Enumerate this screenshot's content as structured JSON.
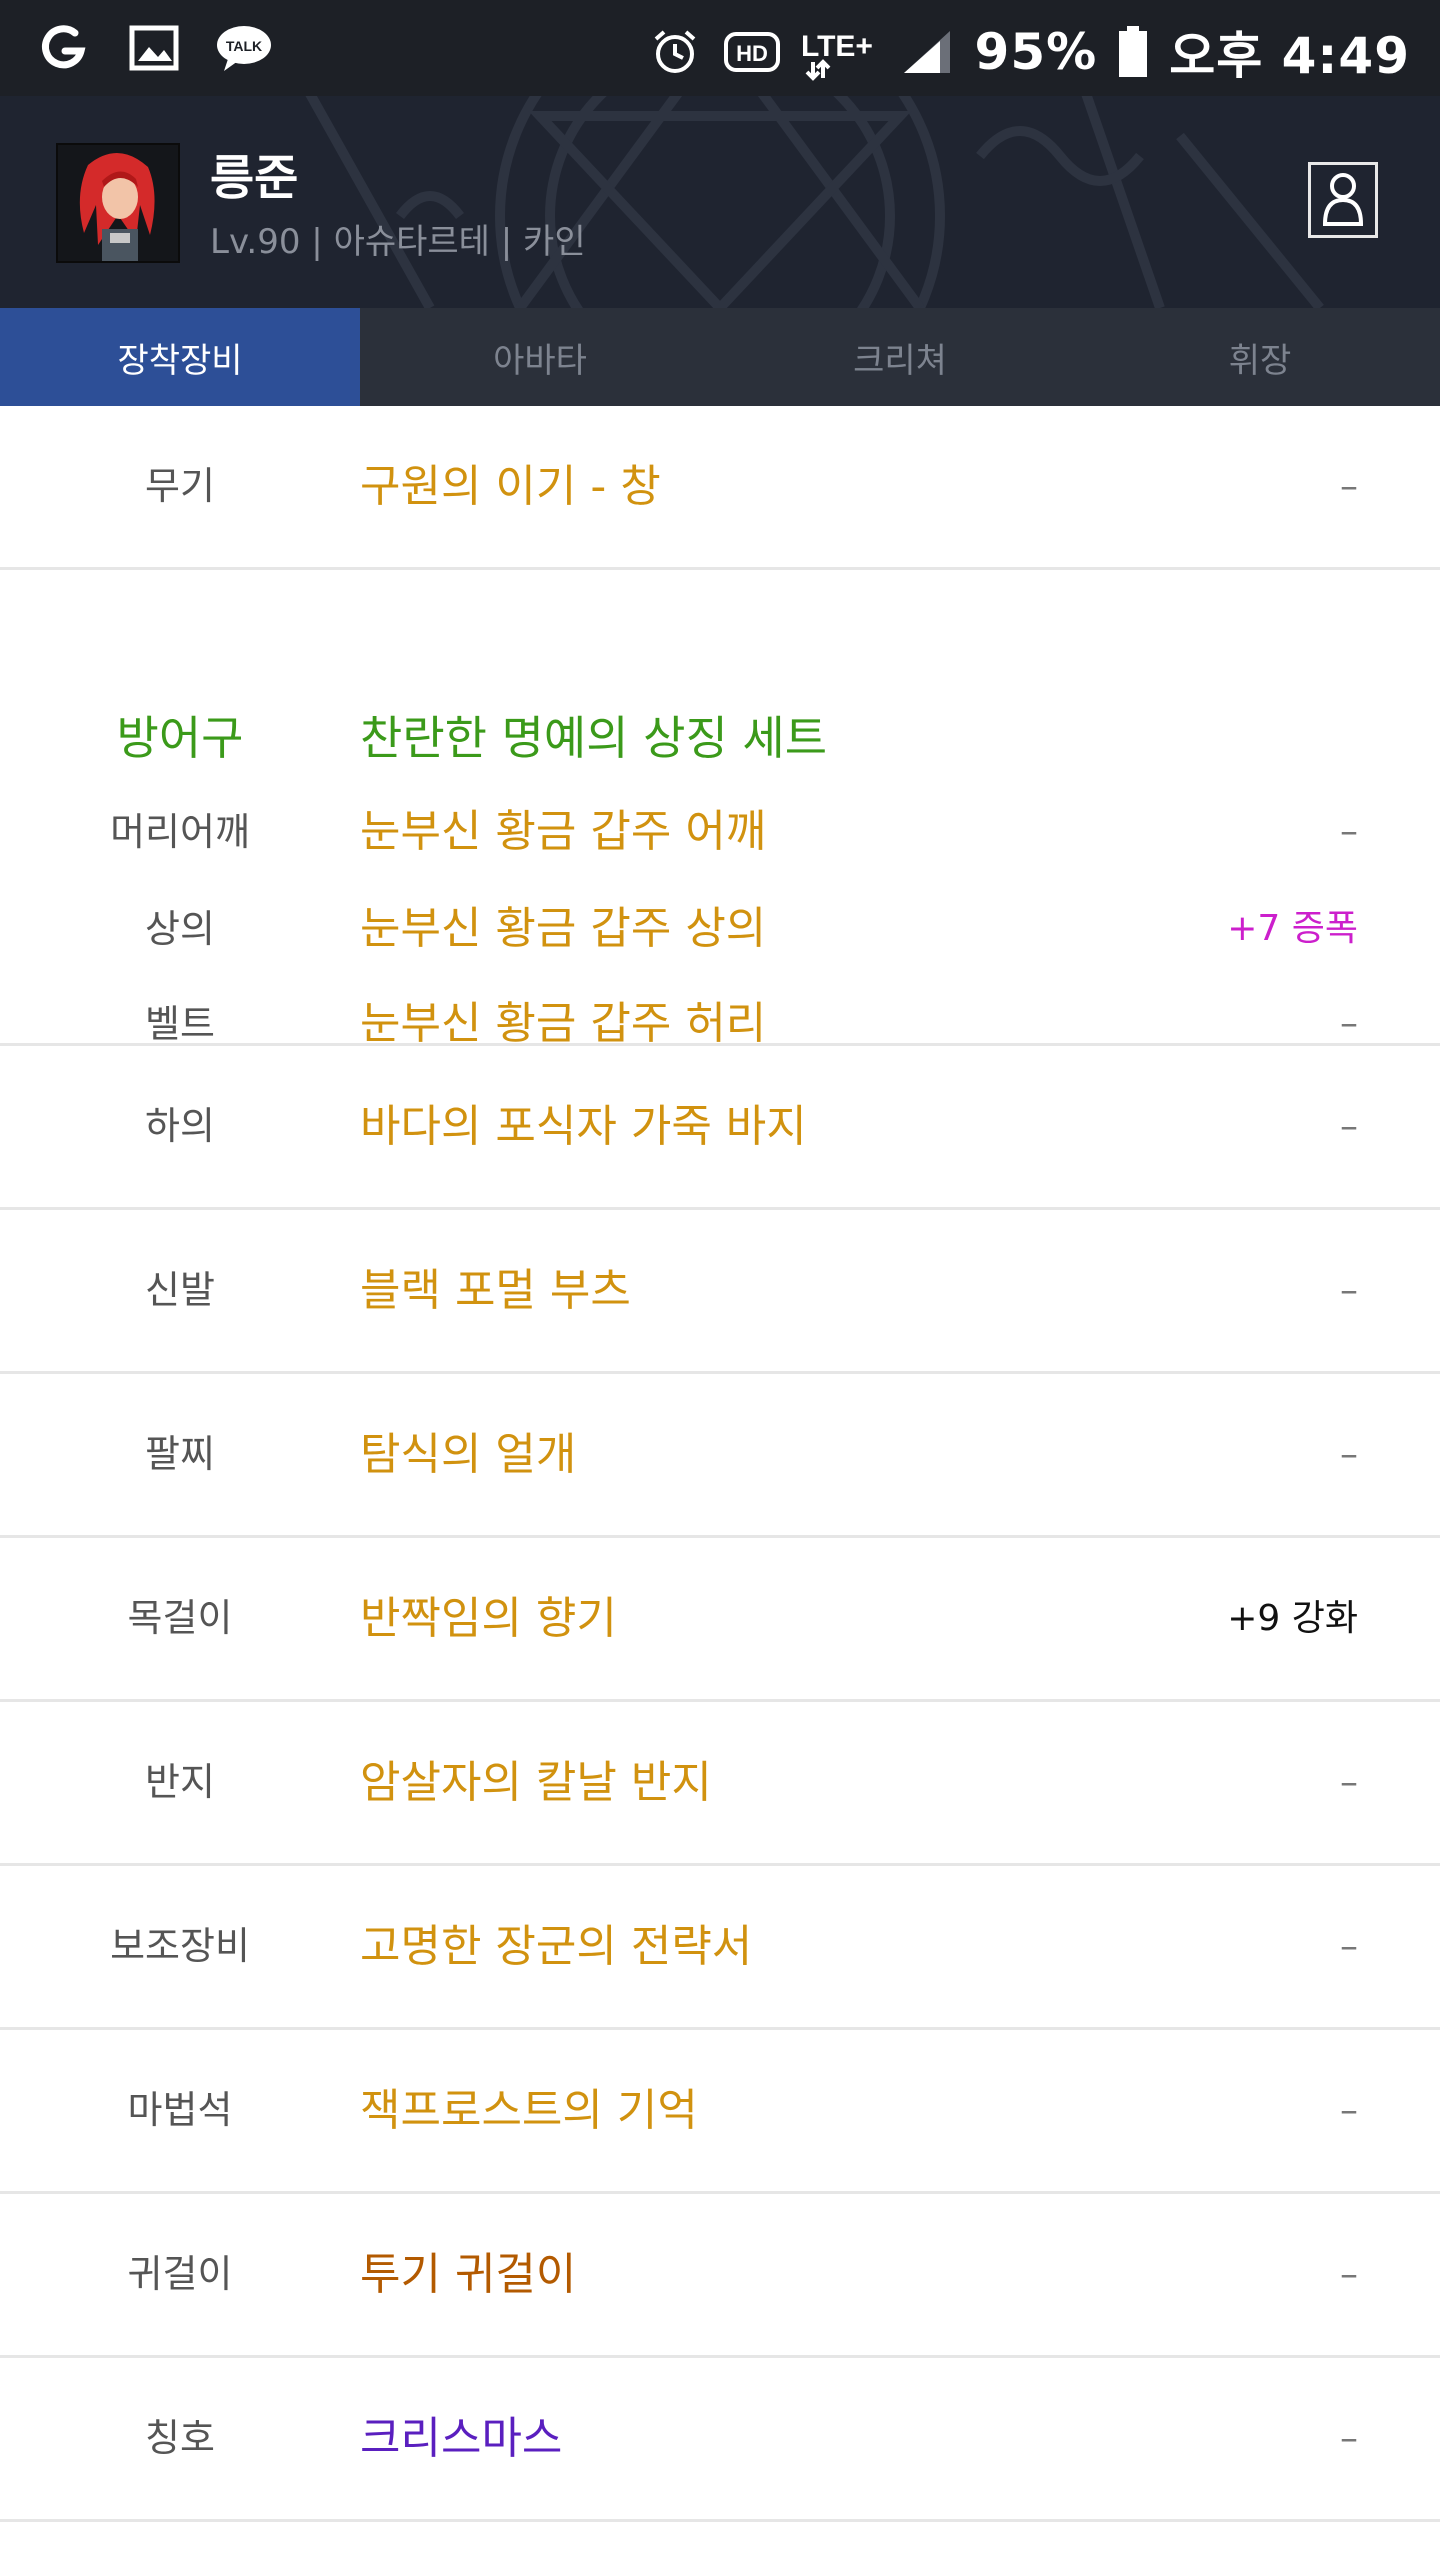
{
  "status_bar": {
    "icons_left": [
      "g-app-icon",
      "gallery-icon",
      "talk-icon"
    ],
    "talk_label": "TALK",
    "icons_right": [
      "alarm-icon",
      "hd-icon",
      "lte-icon",
      "signal-icon",
      "battery-icon"
    ],
    "hd_label": "HD",
    "lte_label": "LTE+",
    "battery": "95%",
    "time": "오후 4:49"
  },
  "profile": {
    "name": "릉준",
    "meta": "Lv.90 | 아슈타르테 | 카인"
  },
  "tabs": [
    {
      "label": "장착장비",
      "active": true
    },
    {
      "label": "아바타",
      "active": false
    },
    {
      "label": "크리쳐",
      "active": false
    },
    {
      "label": "휘장",
      "active": false
    }
  ],
  "equipment": {
    "weapon": {
      "slot": "무기",
      "item": "구원의 이기 - 창",
      "extra": "–"
    },
    "armor_set": {
      "slot": "방어구",
      "set_name": "찬란한 명예의 상징 세트",
      "pieces": [
        {
          "slot": "머리어깨",
          "item": "눈부신 황금 갑주 어깨",
          "extra": "–"
        },
        {
          "slot": "상의",
          "item": "눈부신 황금 갑주 상의",
          "extra": "+7 증폭"
        },
        {
          "slot": "벨트",
          "item": "눈부신 황금 갑주 허리",
          "extra": "–"
        }
      ]
    },
    "rows": [
      {
        "slot": "하의",
        "item": "바다의 포식자 가죽 바지",
        "extra": "–"
      },
      {
        "slot": "신발",
        "item": "블랙 포멀 부츠",
        "extra": "–"
      },
      {
        "slot": "팔찌",
        "item": "탐식의 얼개",
        "extra": "–"
      },
      {
        "slot": "목걸이",
        "item": "반짝임의 향기",
        "extra": "+9 강화"
      },
      {
        "slot": "반지",
        "item": "암살자의 칼날 반지",
        "extra": "–"
      },
      {
        "slot": "보조장비",
        "item": "고명한 장군의 전략서",
        "extra": "–"
      },
      {
        "slot": "마법석",
        "item": "잭프로스트의 기억",
        "extra": "–"
      },
      {
        "slot": "귀걸이",
        "item": "투기 귀걸이",
        "extra": "–"
      },
      {
        "slot": "칭호",
        "item": "크리스마스",
        "extra": "–"
      }
    ]
  },
  "colors": {
    "item_unique": "#d1920f",
    "item_set": "#3b9a1a",
    "item_legendary": "#b35a00",
    "item_epic_title": "#5a1fbf",
    "amplify": "#cc1fcc",
    "tab_active": "#2d4f97"
  }
}
